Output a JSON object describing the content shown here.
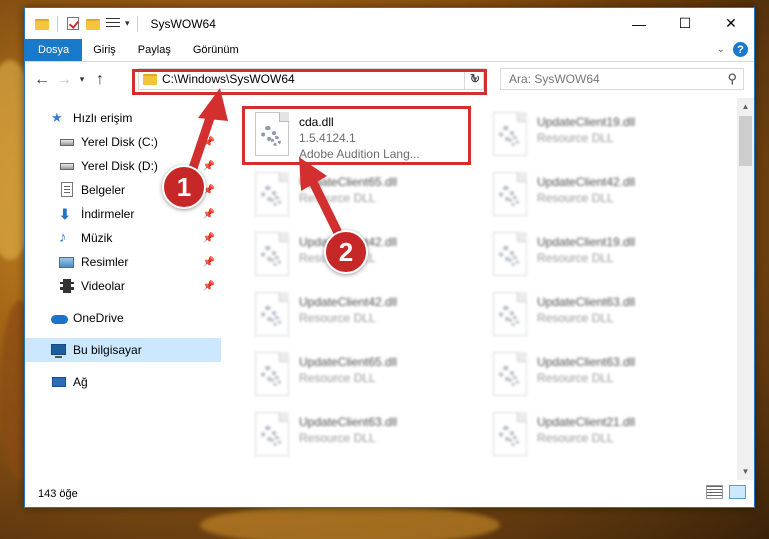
{
  "window": {
    "title": "SysWOW64",
    "controls": {
      "minimize": "—",
      "maximize": "☐",
      "close": "✕"
    }
  },
  "ribbon": {
    "tabs": [
      "Dosya",
      "Giriş",
      "Paylaş",
      "Görünüm"
    ],
    "help": "?"
  },
  "nav": {
    "address": "C:\\Windows\\SysWOW64",
    "search_placeholder": "Ara: SysWOW64"
  },
  "sidebar": {
    "items": [
      {
        "label": "Hızlı erişim"
      },
      {
        "label": "Yerel Disk (C:)"
      },
      {
        "label": "Yerel Disk (D:)"
      },
      {
        "label": "Belgeler"
      },
      {
        "label": "İndirmeler"
      },
      {
        "label": "Müzik"
      },
      {
        "label": "Resimler"
      },
      {
        "label": "Videolar"
      },
      {
        "label": "OneDrive"
      },
      {
        "label": "Bu bilgisayar"
      },
      {
        "label": "Ağ"
      }
    ]
  },
  "files": [
    {
      "name": "cda.dll",
      "line2": "1.5.4124.1",
      "line3": "Adobe Audition Lang..."
    },
    {
      "name": "UpdateClient19.dll",
      "line2": "Resource DLL"
    },
    {
      "name": "UpdateClient65.dll",
      "line2": "Resource DLL"
    },
    {
      "name": "UpdateClient42.dll",
      "line2": "Resource DLL"
    },
    {
      "name": "UpdateClient42.dll",
      "line2": "Resource DLL"
    },
    {
      "name": "UpdateClient19.dll",
      "line2": "Resource DLL"
    },
    {
      "name": "UpdateClient42.dll",
      "line2": "Resource DLL"
    },
    {
      "name": "UpdateClient63.dll",
      "line2": "Resource DLL"
    },
    {
      "name": "UpdateClient65.dll",
      "line2": "Resource DLL"
    },
    {
      "name": "UpdateClient63.dll",
      "line2": "Resource DLL"
    },
    {
      "name": "UpdateClient63.dll",
      "line2": "Resource DLL"
    },
    {
      "name": "UpdateClient21.dll",
      "line2": "Resource DLL"
    }
  ],
  "status": {
    "count": "143 öğe"
  },
  "annotations": {
    "badge1": "1",
    "badge2": "2",
    "color": "#d32f2f"
  }
}
